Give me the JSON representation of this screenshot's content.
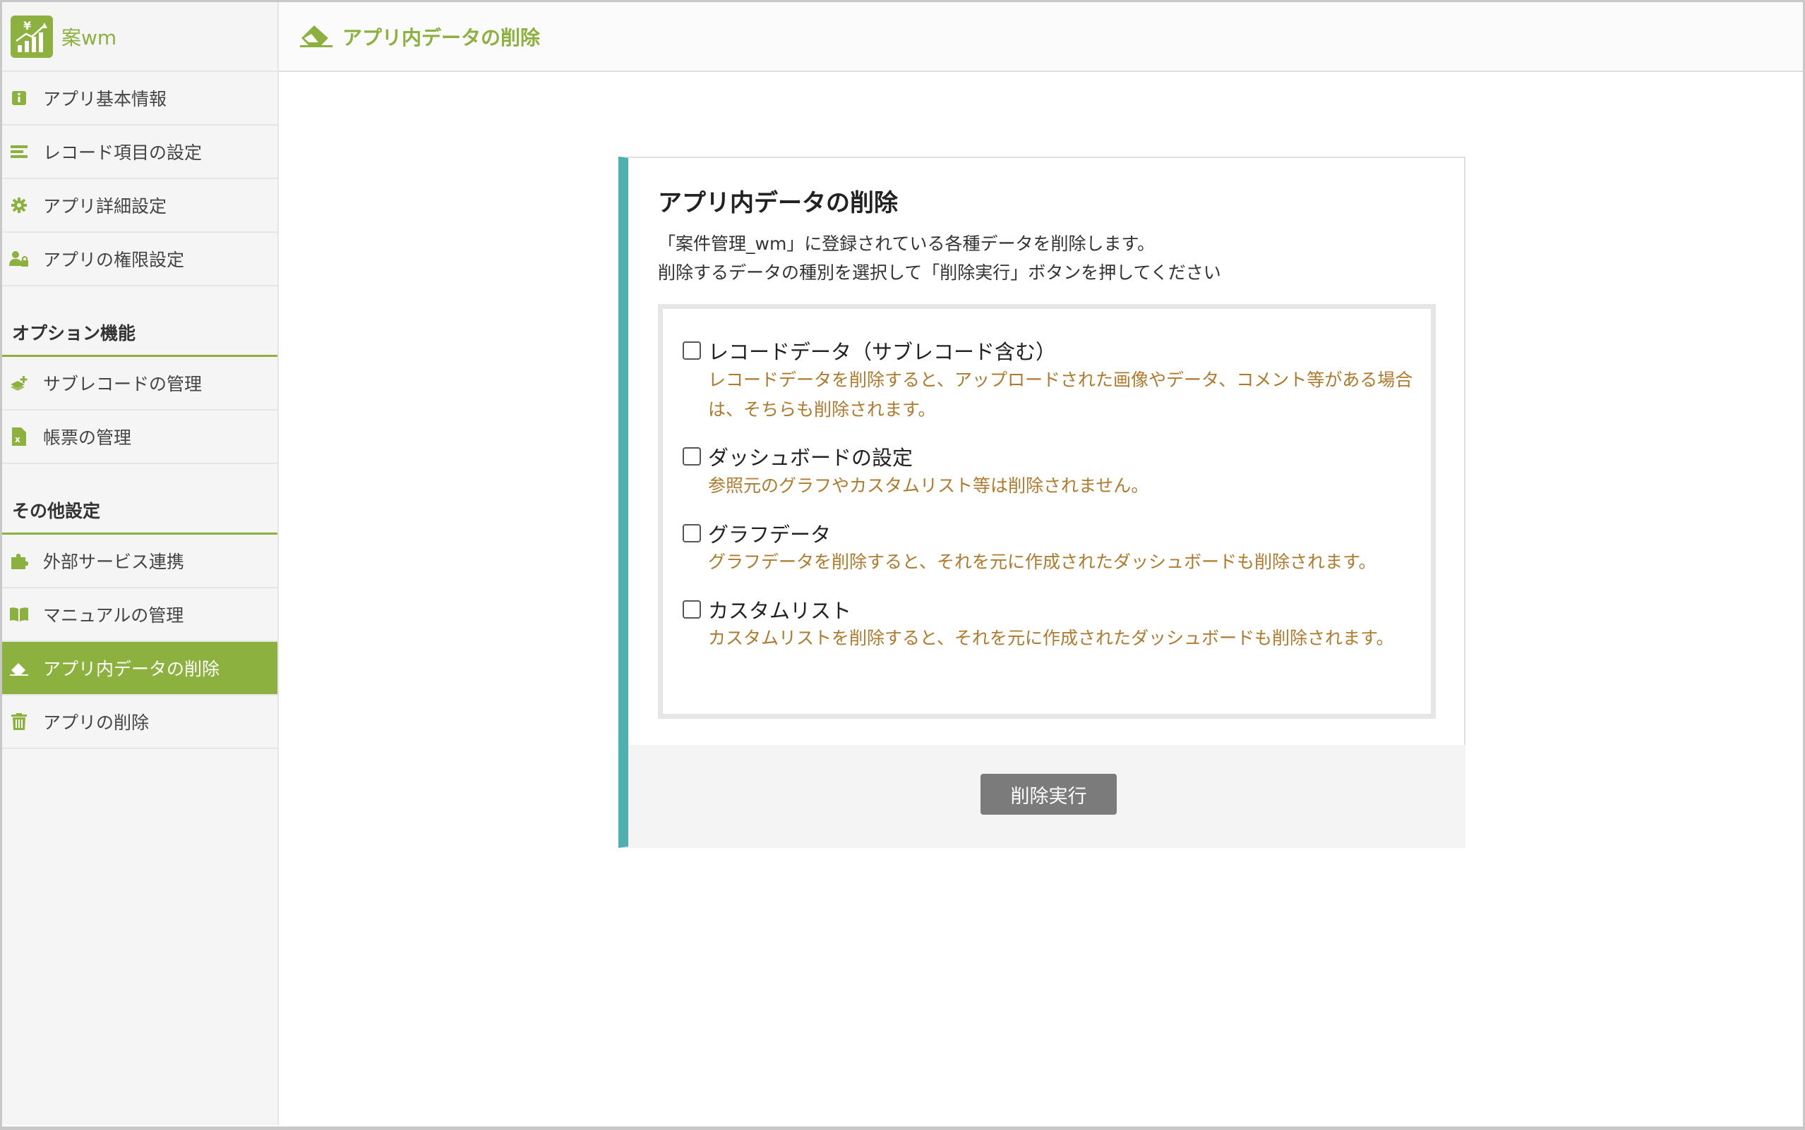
{
  "app": {
    "name": "案wm",
    "page_title": "アプリ内データの削除"
  },
  "sidebar": {
    "items_top": [
      {
        "label": "アプリ基本情報",
        "icon": "info-icon"
      },
      {
        "label": "レコード項目の設定",
        "icon": "list-icon"
      },
      {
        "label": "アプリ詳細設定",
        "icon": "gear-icon"
      },
      {
        "label": "アプリの権限設定",
        "icon": "user-lock-icon"
      }
    ],
    "section_options": "オプション機能",
    "items_options": [
      {
        "label": "サブレコードの管理",
        "icon": "layers-plus-icon"
      },
      {
        "label": "帳票の管理",
        "icon": "excel-file-icon"
      }
    ],
    "section_other": "その他設定",
    "items_other": [
      {
        "label": "外部サービス連携",
        "icon": "puzzle-icon"
      },
      {
        "label": "マニュアルの管理",
        "icon": "book-icon"
      },
      {
        "label": "アプリ内データの削除",
        "icon": "eraser-icon",
        "active": true
      },
      {
        "label": "アプリの削除",
        "icon": "trash-icon"
      }
    ]
  },
  "card": {
    "title": "アプリ内データの削除",
    "desc_line1": "「案件管理_wm」に登録されている各種データを削除します。",
    "desc_line2": "削除するデータの種別を選択して「削除実行」ボタンを押してください",
    "options": [
      {
        "label": "レコードデータ（サブレコード含む）",
        "note": "レコードデータを削除すると、アップロードされた画像やデータ、コメント等がある場合は、そちらも削除されます。",
        "checked": false
      },
      {
        "label": "ダッシュボードの設定",
        "note": "参照元のグラフやカスタムリスト等は削除されません。",
        "checked": false
      },
      {
        "label": "グラフデータ",
        "note": "グラフデータを削除すると、それを元に作成されたダッシュボードも削除されます。",
        "checked": false
      },
      {
        "label": "カスタムリスト",
        "note": "カスタムリストを削除すると、それを元に作成されたダッシュボードも削除されます。",
        "checked": false
      }
    ],
    "submit_label": "削除実行"
  },
  "colors": {
    "accent_green": "#8db13e",
    "card_accent_teal": "#4db0b1",
    "note_text": "#b07a2c",
    "button_gray": "#7b7b7b"
  }
}
